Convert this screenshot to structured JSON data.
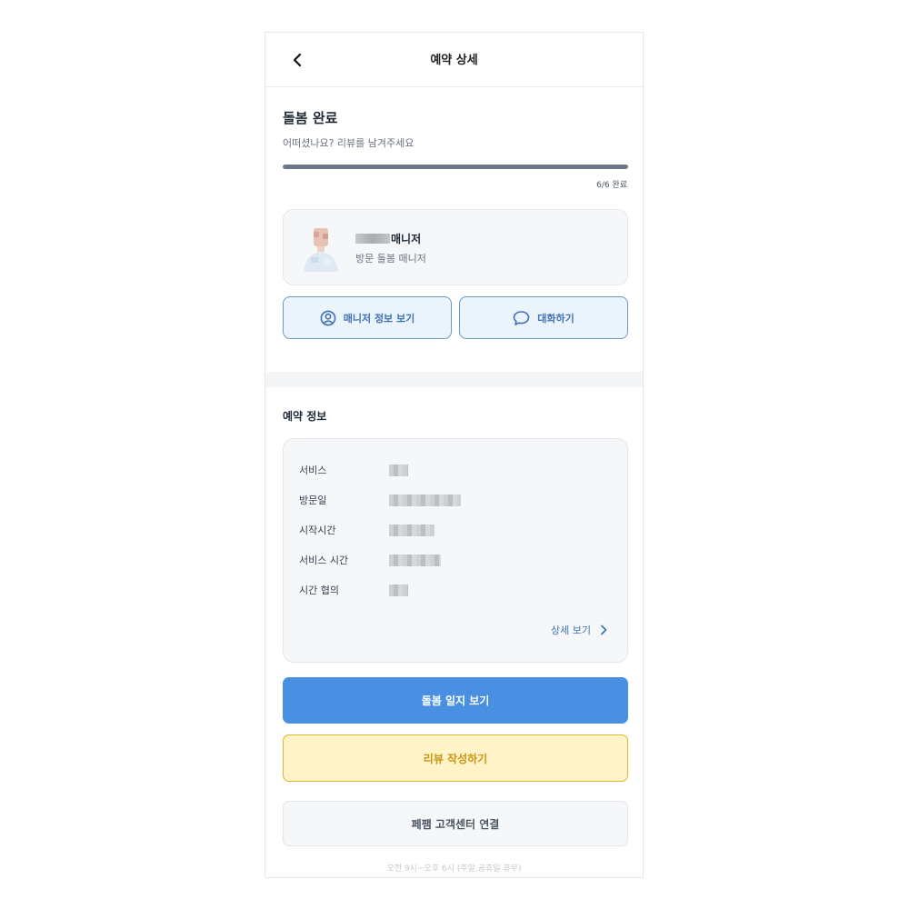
{
  "header": {
    "title": "예약 상세",
    "back_icon": "chevron-left-icon"
  },
  "status": {
    "title": "돌봄 완료",
    "subtitle": "어떠셨나요? 리뷰를 남겨주세요",
    "progress_fraction": 1.0,
    "progress_text": "6/6 완료",
    "progress_color": "#6b7789"
  },
  "manager": {
    "name_suffix": "매니저",
    "role": "방문 돌봄 매니저"
  },
  "actions": {
    "info_label": "매니저 정보 보기",
    "info_icon": "user-circle-icon",
    "chat_label": "대화하기",
    "chat_icon": "chat-bubble-icon"
  },
  "reservation": {
    "section_title": "예약 정보",
    "rows": [
      {
        "label": "서비스"
      },
      {
        "label": "방문일"
      },
      {
        "label": "시작시간"
      },
      {
        "label": "서비스 시간"
      },
      {
        "label": "시간 협의"
      }
    ],
    "detail_link": "상세 보기"
  },
  "buttons": {
    "journal": "돌봄 일지 보기",
    "review": "리뷰 작성하기",
    "customer_center": "페팸 고객센터 연결"
  },
  "footer": {
    "hours": "오전 9시~오후 6시 (주말,공휴일 휴무)"
  },
  "colors": {
    "accent_blue": "#4a90e2",
    "review_yellow": "#fff3c8",
    "review_border": "#e3b52b",
    "link_blue": "#3f72b4"
  }
}
